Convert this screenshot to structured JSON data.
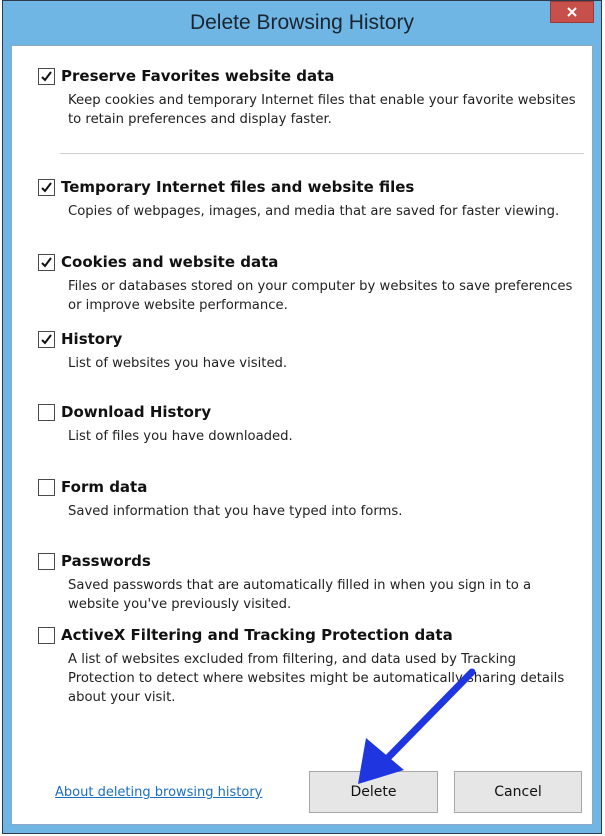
{
  "dialog": {
    "title": "Delete Browsing History",
    "close_icon": "close-icon"
  },
  "options": [
    {
      "label": "Preserve Favorites website data",
      "description": "Keep cookies and temporary Internet files that enable your favorite websites to retain preferences and display faster.",
      "checked": true
    },
    {
      "label": "Temporary Internet files and website files",
      "description": "Copies of webpages, images, and media that are saved for faster viewing.",
      "checked": true
    },
    {
      "label": "Cookies and website data",
      "description": "Files or databases stored on your computer by websites to save preferences or improve website performance.",
      "checked": true
    },
    {
      "label": "History",
      "description": "List of websites you have visited.",
      "checked": true
    },
    {
      "label": "Download History",
      "description": "List of files you have downloaded.",
      "checked": false
    },
    {
      "label": "Form data",
      "description": "Saved information that you have typed into forms.",
      "checked": false
    },
    {
      "label": "Passwords",
      "description": "Saved passwords that are automatically filled in when you sign in to a website you've previously visited.",
      "checked": false
    },
    {
      "label": "ActiveX Filtering and Tracking Protection data",
      "description": "A list of websites excluded from filtering, and data used by Tracking Protection to detect where websites might be automatically sharing details about your visit.",
      "checked": false
    }
  ],
  "footer": {
    "about_link": "About deleting browsing history",
    "delete_label": "Delete",
    "cancel_label": "Cancel"
  },
  "colors": {
    "titlebar": "#6fb6e4",
    "close_button": "#c7504a",
    "link": "#1a6fc0",
    "annotation_arrow": "#1f35e0"
  }
}
